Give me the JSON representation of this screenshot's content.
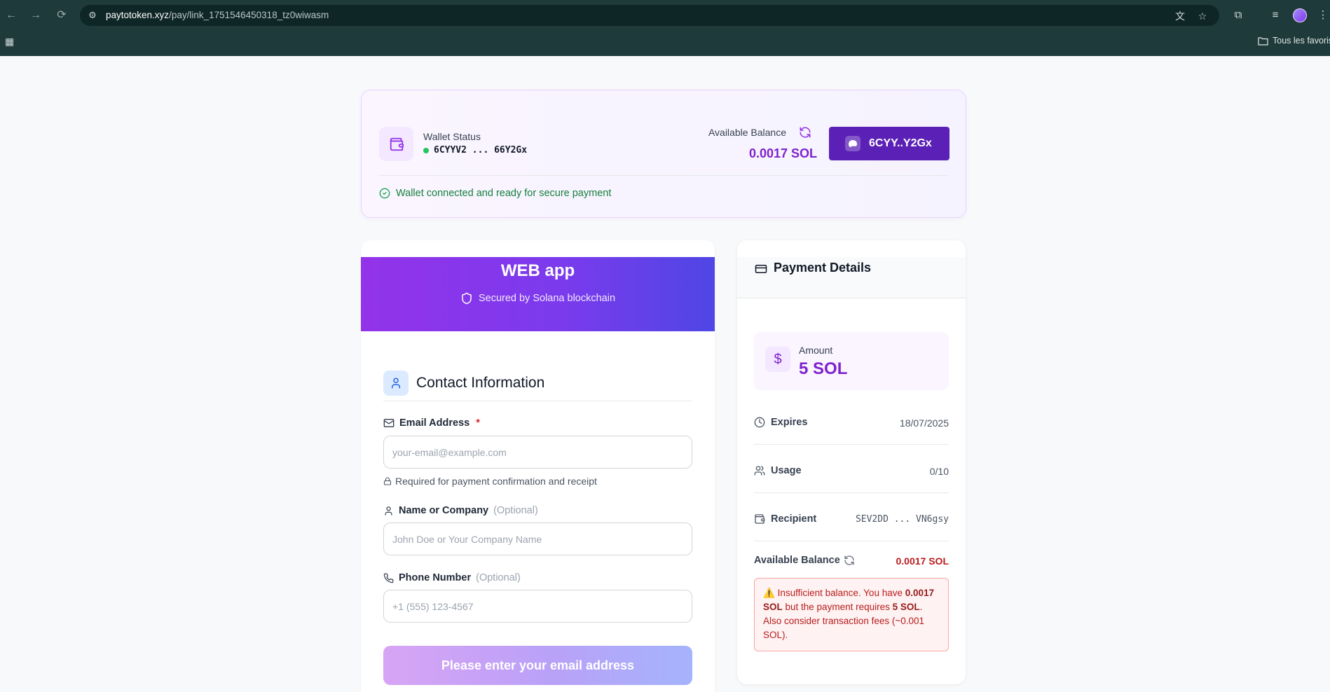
{
  "browser": {
    "url_host": "paytotoken.xyz",
    "url_path": "/pay/link_1751546450318_tz0wiwasm",
    "bookmarks_folder": "Tous les favoris"
  },
  "wallet": {
    "status_label": "Wallet Status",
    "address_short": "6CYYV2 ... 66Y2Gx",
    "available_label": "Available Balance",
    "available_value": "0.0017 SOL",
    "button_label": "6CYY..Y2Gx",
    "ready_message": "Wallet connected and ready for secure payment"
  },
  "app": {
    "title": "WEB app",
    "secured_text": "Secured by Solana blockchain"
  },
  "contact": {
    "section_title": "Contact Information",
    "email_label": "Email Address",
    "email_required_mark": "*",
    "email_placeholder": "your-email@example.com",
    "email_hint": "Required for payment confirmation and receipt",
    "name_label": "Name or Company",
    "name_optional": "(Optional)",
    "name_placeholder": "John Doe or Your Company Name",
    "phone_label": "Phone Number",
    "phone_optional": "(Optional)",
    "phone_placeholder": "+1 (555) 123-4567",
    "submit_label": "Please enter your email address"
  },
  "payment": {
    "title": "Payment Details",
    "amount_label": "Amount",
    "amount_value": "5 SOL",
    "expires_label": "Expires",
    "expires_value": "18/07/2025",
    "usage_label": "Usage",
    "usage_value": "0/10",
    "recipient_label": "Recipient",
    "recipient_value": "SEV2DD ... VN6gsy",
    "balance_label": "Available Balance",
    "balance_value": "0.0017 SOL",
    "warning_icon": "⚠️",
    "warning_pre": "Insufficient balance. You have ",
    "warning_have": "0.0017 SOL",
    "warning_mid": " but the payment requires ",
    "warning_need": "5 SOL",
    "warning_post": ". Also consider transaction fees (~0.001 SOL)."
  }
}
